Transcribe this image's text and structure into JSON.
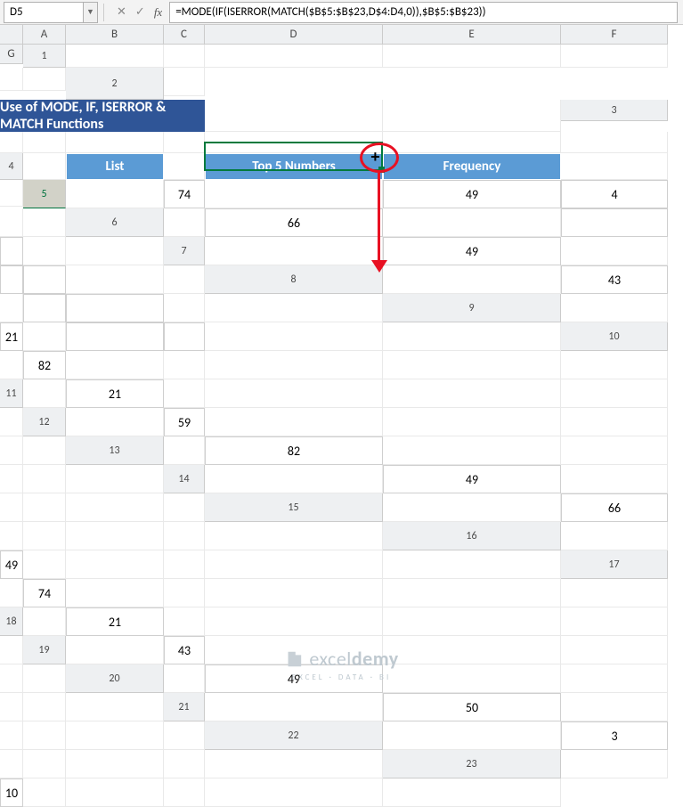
{
  "namebox": "D5",
  "formula": "=MODE(IF(ISERROR(MATCH($B$5:$B$23,D$4:D4,0)),$B$5:$B$23))",
  "cols": [
    "A",
    "B",
    "C",
    "D",
    "E",
    "F",
    "G"
  ],
  "rows": [
    "1",
    "2",
    "3",
    "4",
    "5",
    "6",
    "7",
    "8",
    "9",
    "10",
    "11",
    "12",
    "13",
    "14",
    "15",
    "16",
    "17",
    "18",
    "19",
    "20",
    "21",
    "22",
    "23"
  ],
  "banner": "Use of MODE, IF, ISERROR & MATCH Functions",
  "headers": {
    "list": "List",
    "top5": "Top 5 Numbers",
    "freq": "Frequency"
  },
  "list": [
    "74",
    "66",
    "49",
    "43",
    "21",
    "82",
    "21",
    "59",
    "82",
    "49",
    "66",
    "49",
    "74",
    "21",
    "43",
    "49",
    "50",
    "3",
    "10"
  ],
  "top5": {
    "val": "49",
    "freq": "4"
  },
  "logo": {
    "name_a": "excel",
    "name_b": "demy",
    "sub": "EXCEL · DATA · BI"
  }
}
